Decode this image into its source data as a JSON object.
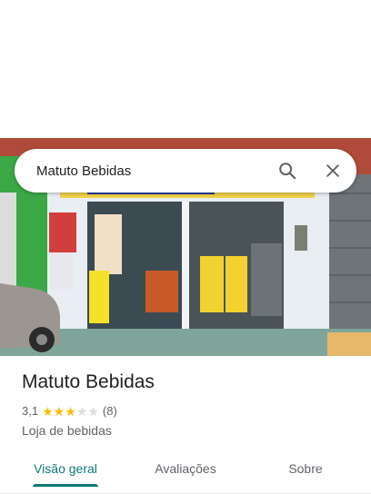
{
  "search": {
    "query": "Matuto Bebidas"
  },
  "icons": {
    "search": "search-icon",
    "close": "close-icon"
  },
  "place": {
    "name": "Matuto Bebidas",
    "rating": "3,1",
    "rating_value": 3.1,
    "stars_max": 5,
    "review_count": "(8)",
    "category": "Loja de bebidas"
  },
  "tabs": [
    {
      "label": "Visão geral",
      "active": true
    },
    {
      "label": "Avaliações",
      "active": false
    },
    {
      "label": "Sobre",
      "active": false
    }
  ],
  "colors": {
    "accent": "#0b7a75",
    "star": "#fbbc04",
    "star_empty": "#dadce0"
  }
}
